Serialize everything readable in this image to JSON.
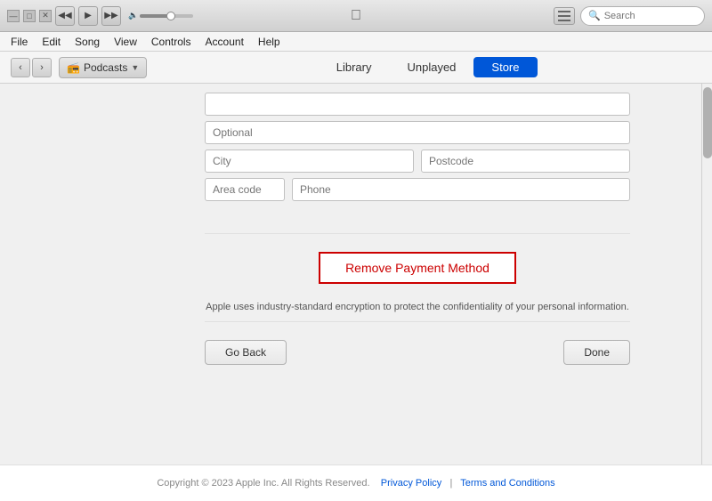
{
  "titlebar": {
    "btn_prev": "◀",
    "btn_play": "▶",
    "btn_next": "▶▶",
    "apple_symbol": "",
    "search_placeholder": "Search",
    "win_min": "—",
    "win_max": "□",
    "win_close": "✕"
  },
  "menubar": {
    "items": [
      "File",
      "Edit",
      "Song",
      "View",
      "Controls",
      "Account",
      "Help"
    ]
  },
  "toolbar": {
    "nav_back": "‹",
    "nav_forward": "›",
    "podcast_label": "Podcasts",
    "tabs": [
      {
        "label": "Library",
        "active": false
      },
      {
        "label": "Unplayed",
        "active": false
      },
      {
        "label": "Store",
        "active": true
      }
    ]
  },
  "form": {
    "optional_placeholder": "Optional",
    "city_placeholder": "City",
    "postcode_placeholder": "Postcode",
    "area_code_placeholder": "Area code",
    "phone_placeholder": "Phone"
  },
  "remove_button": {
    "label": "Remove Payment Method"
  },
  "privacy_note": "Apple uses industry-standard encryption to protect the confidentiality of your personal information.",
  "buttons": {
    "go_back": "Go Back",
    "done": "Done"
  },
  "footer": {
    "copyright": "Copyright © 2023 Apple Inc. All Rights Reserved.",
    "privacy_policy": "Privacy Policy",
    "separator": "|",
    "terms": "Terms and Conditions"
  }
}
